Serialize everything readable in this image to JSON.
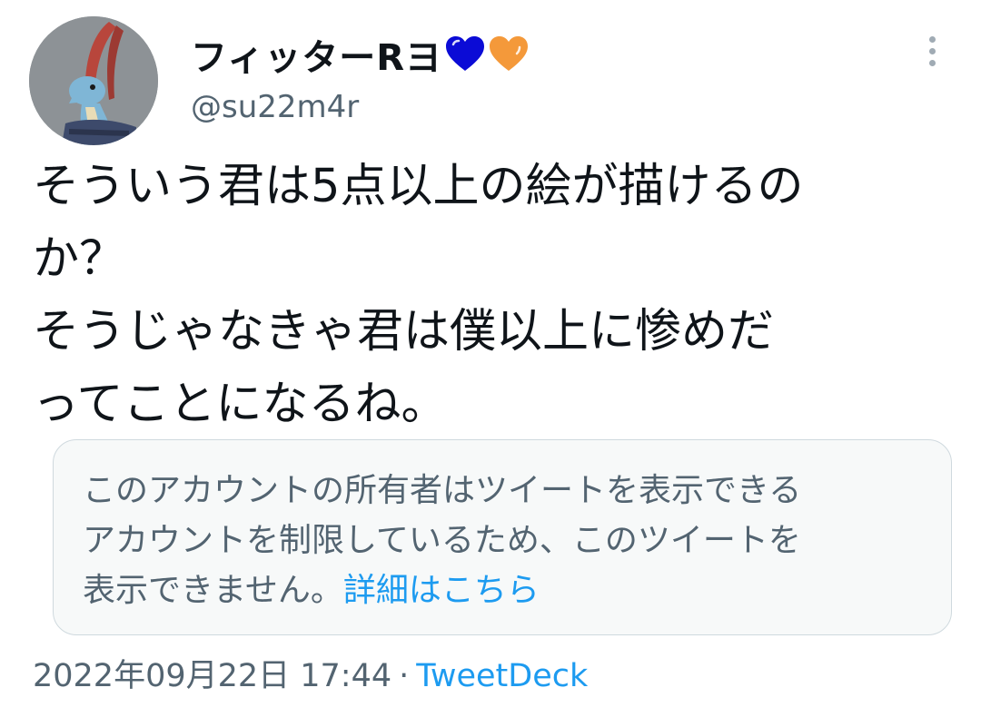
{
  "tweet": {
    "author": {
      "display_name": "フィッターRヨ",
      "handle": "@su22m4r",
      "name_emojis": [
        {
          "icon": "blue-heart-icon",
          "color": "#0b0bd6"
        },
        {
          "icon": "orange-heart-icon",
          "color": "#f4993a"
        }
      ]
    },
    "text_lines": [
      "そういう君は5点以上の絵が描けるの",
      "か？",
      "そうじゃなきゃ君は僕以上に惨めだ",
      "ってことになるね。"
    ],
    "withheld_notice": {
      "lines": [
        "このアカウントの所有者はツイートを表示できる",
        "アカウントを制限しているため、このツイートを",
        "表示できません。"
      ],
      "link_label": "詳細はこちら"
    },
    "timestamp": "2022年09月22日 17:44",
    "separator": "·",
    "source": "TweetDeck"
  },
  "colors": {
    "text_primary": "#0f1419",
    "text_secondary": "#536471",
    "link": "#1d9bf0",
    "notice_bg": "#f7f9f9",
    "notice_border": "#cfd9de"
  }
}
